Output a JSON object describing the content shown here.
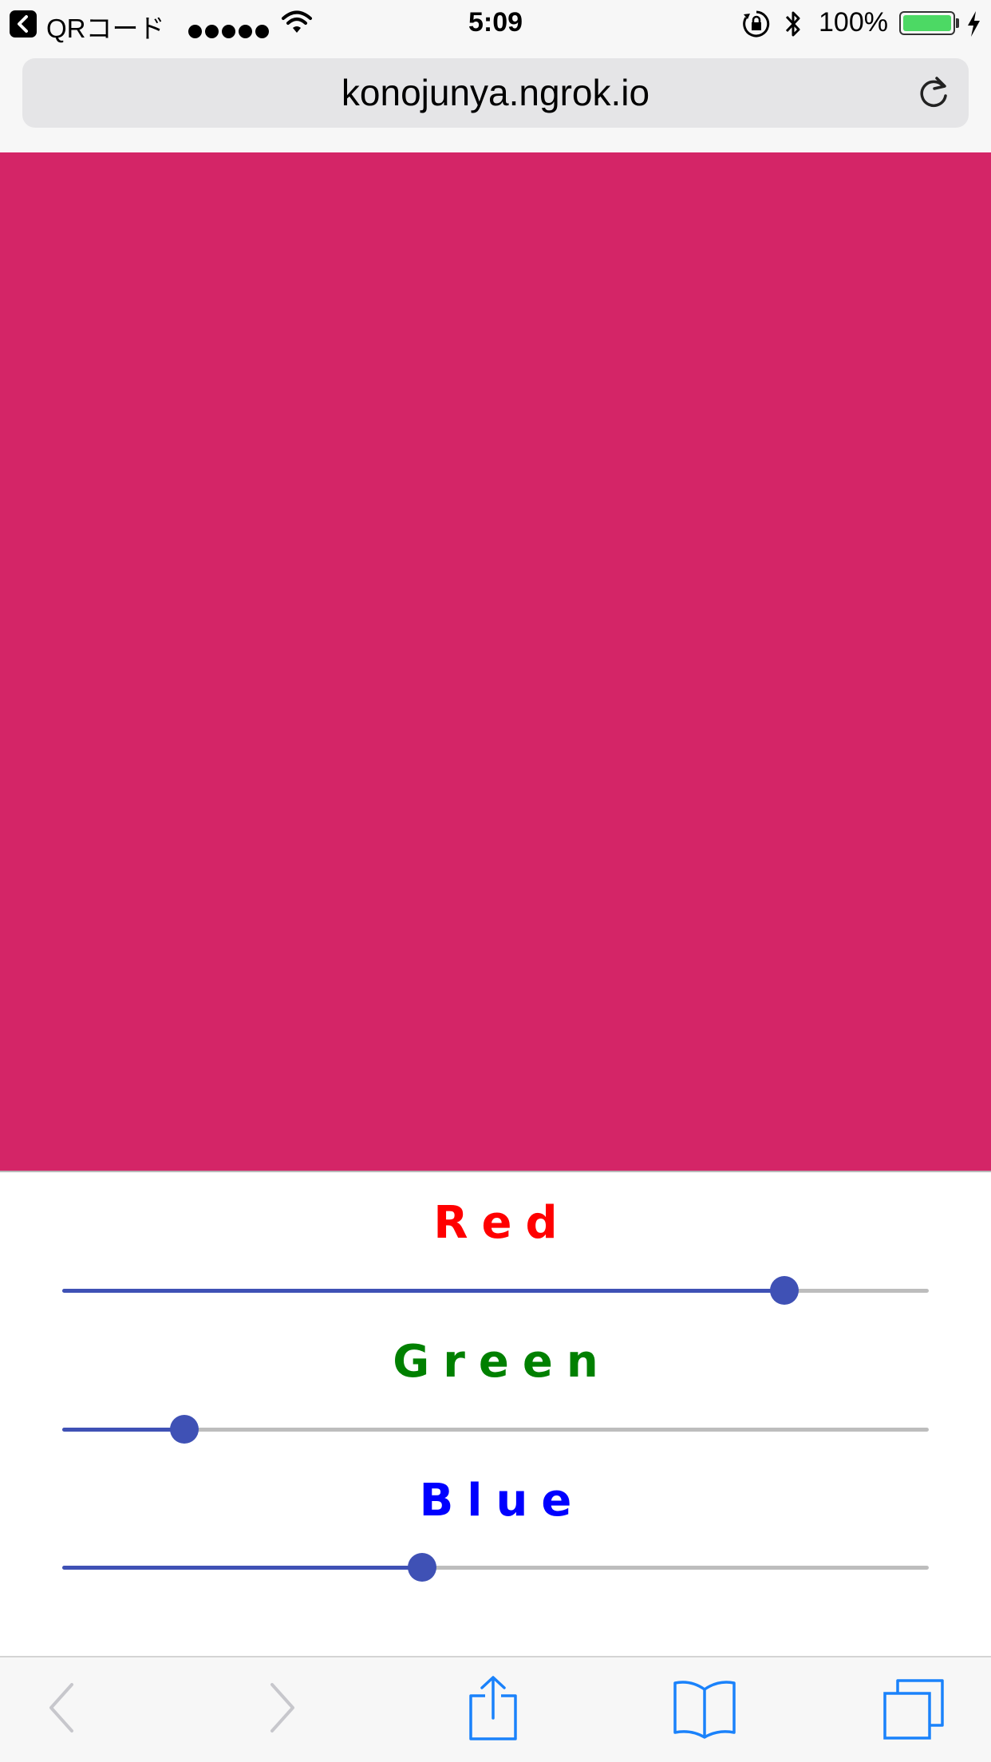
{
  "status_bar": {
    "back_app": "QRコード",
    "time": "5:09",
    "battery": "100%"
  },
  "address_bar": {
    "url": "konojunya.ngrok.io"
  },
  "preview": {
    "color": "#d42567"
  },
  "sliders": [
    {
      "label": "Red",
      "color": "#ff0000",
      "value_fraction": 0.833
    },
    {
      "label": "Green",
      "color": "#008000",
      "value_fraction": 0.141
    },
    {
      "label": "Blue",
      "color": "#0000ff",
      "value_fraction": 0.415
    }
  ],
  "theme": {
    "slider_accent": "#3f51b5",
    "toolbar_tint": "#1a82fb"
  },
  "toolbar": {
    "icons": [
      "back-icon",
      "forward-icon",
      "share-icon",
      "bookmarks-icon",
      "tabs-icon"
    ]
  }
}
